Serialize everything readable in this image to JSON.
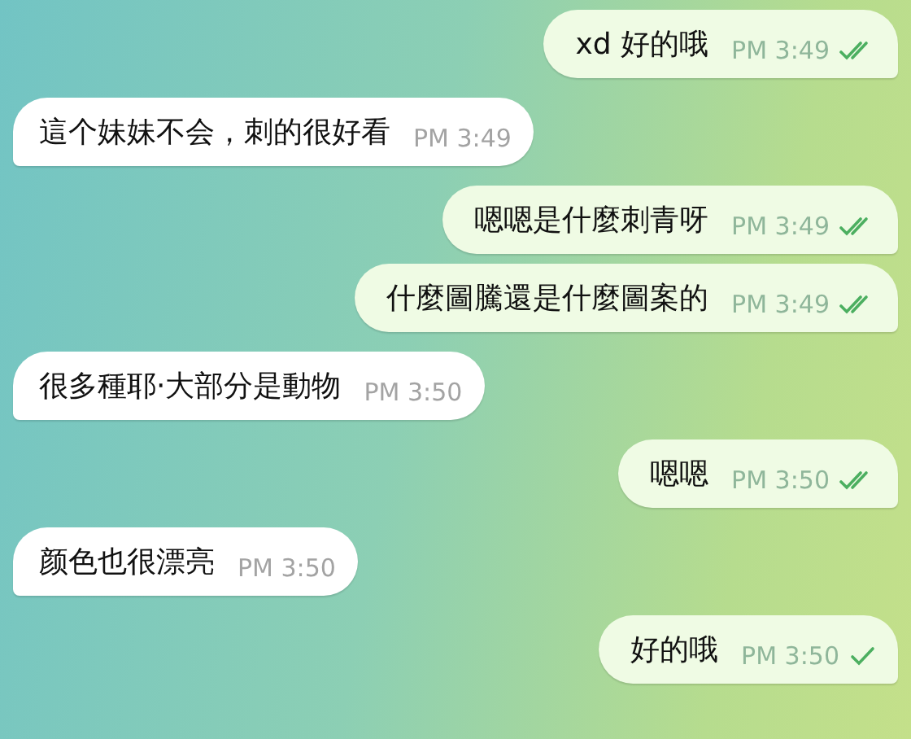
{
  "messages": [
    {
      "kind": "outgoing",
      "text": "xd 好的哦",
      "time": "PM 3:49",
      "read": true
    },
    {
      "kind": "incoming",
      "text": "這个妹妹不会，刺的很好看",
      "time": "PM 3:49"
    },
    {
      "kind": "outgoing",
      "text": "嗯嗯是什麼刺青呀",
      "time": "PM 3:49",
      "read": true
    },
    {
      "kind": "outgoing",
      "text": "什麼圖騰還是什麼圖案的",
      "time": "PM 3:49",
      "read": true
    },
    {
      "kind": "incoming",
      "text": "很多種耶·大部分是動物",
      "time": "PM 3:50"
    },
    {
      "kind": "outgoing",
      "text": "嗯嗯",
      "time": "PM 3:50",
      "read": true
    },
    {
      "kind": "incoming",
      "text": "颜色也很漂亮",
      "time": "PM 3:50"
    },
    {
      "kind": "outgoing",
      "text": "好的哦",
      "time": "PM 3:50",
      "read": false
    }
  ]
}
